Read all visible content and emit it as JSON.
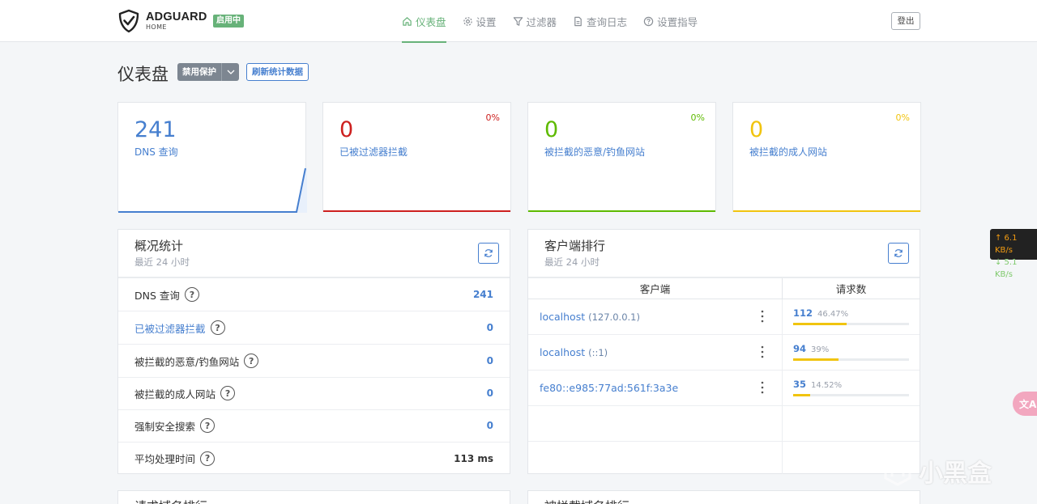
{
  "header": {
    "brand": "ADGUARD",
    "brand_sub": "HOME",
    "status": "启用中",
    "nav": [
      {
        "label": "仪表盘",
        "icon": "home-icon",
        "active": true
      },
      {
        "label": "设置",
        "icon": "gear-icon"
      },
      {
        "label": "过滤器",
        "icon": "filter-icon"
      },
      {
        "label": "查询日志",
        "icon": "document-icon"
      },
      {
        "label": "设置指导",
        "icon": "help-circle-icon"
      }
    ],
    "logout": "登出"
  },
  "page": {
    "title": "仪表盘",
    "disable_protection": "禁用保护",
    "refresh_stats": "刷新统计数据"
  },
  "stat_cards": [
    {
      "value": "241",
      "label": "DNS 查询",
      "percent": "",
      "color": "#467fcf"
    },
    {
      "value": "0",
      "label": "已被过滤器拦截",
      "percent": "0%",
      "color": "#cd201f"
    },
    {
      "value": "0",
      "label": "被拦截的恶意/钓鱼网站",
      "percent": "0%",
      "color": "#5eba00"
    },
    {
      "value": "0",
      "label": "被拦截的成人网站",
      "percent": "0%",
      "color": "#f1c40f"
    }
  ],
  "general": {
    "title": "概况统计",
    "subtitle": "最近 24 小时",
    "rows": [
      {
        "label": "DNS 查询",
        "value": "241"
      },
      {
        "label": "已被过滤器拦截",
        "value": "0"
      },
      {
        "label": "被拦截的恶意/钓鱼网站",
        "value": "0"
      },
      {
        "label": "被拦截的成人网站",
        "value": "0"
      },
      {
        "label": "强制安全搜索",
        "value": "0"
      },
      {
        "label": "平均处理时间",
        "value": "113 ms"
      }
    ]
  },
  "clients": {
    "title": "客户端排行",
    "subtitle": "最近 24 小时",
    "col_client": "客户端",
    "col_count": "请求数",
    "rows": [
      {
        "name": "localhost",
        "ip": "(127.0.0.1)",
        "count": "112",
        "percent": "46.47%",
        "fraction": 0.4647
      },
      {
        "name": "localhost",
        "ip": "(::1)",
        "count": "94",
        "percent": "39%",
        "fraction": 0.39
      },
      {
        "name": "fe80::e985:77ad:561f:3a3e",
        "ip": "",
        "count": "35",
        "percent": "14.52%",
        "fraction": 0.1452
      }
    ]
  },
  "bottom": {
    "left_title": "请求域名排行",
    "right_title": "被拦截域名排行"
  },
  "widgets": {
    "upload_speed": "↑ 6.1 KB/s",
    "download_speed": "↓ 5.1 KB/s",
    "translate_label": "文A",
    "watermark": "小黑盒"
  }
}
